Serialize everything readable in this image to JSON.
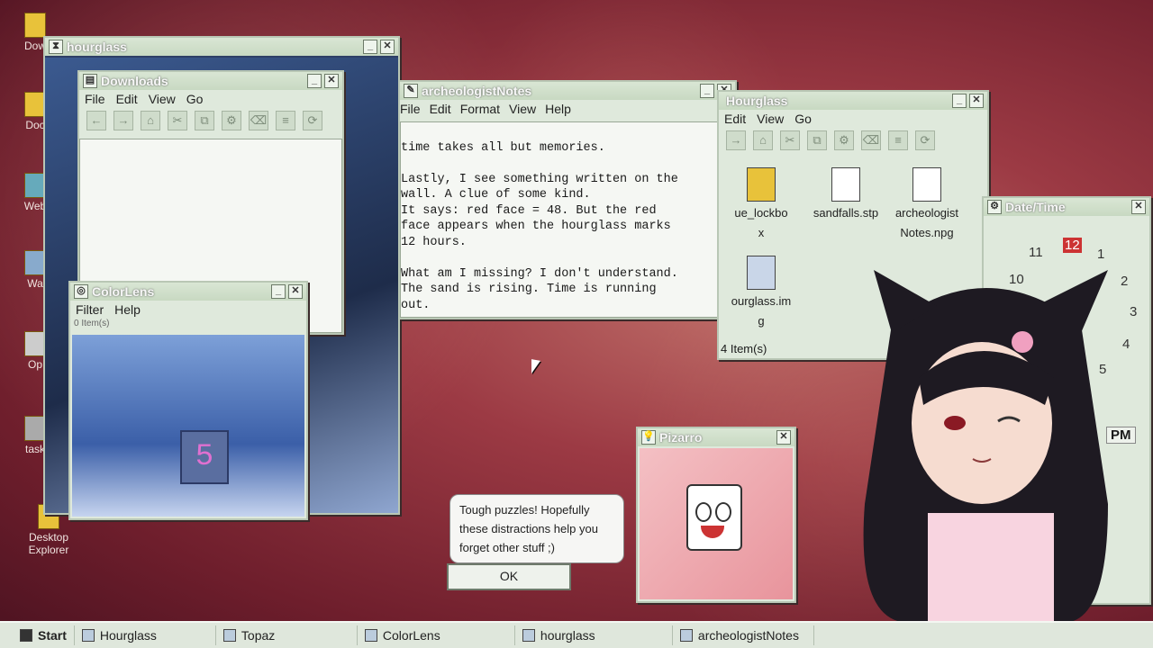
{
  "desktop": {
    "icons": [
      {
        "label": "Dow"
      },
      {
        "label": "Doc"
      },
      {
        "label": "Web"
      },
      {
        "label": "Wa"
      },
      {
        "label": "Op"
      },
      {
        "label": "task"
      },
      {
        "label": "Desktop Explorer"
      }
    ]
  },
  "hourglass_win": {
    "title": "hourglass"
  },
  "downloads": {
    "title": "Downloads",
    "menu": [
      "File",
      "Edit",
      "View",
      "Go"
    ]
  },
  "colorlens": {
    "title": "ColorLens",
    "menu": [
      "Filter",
      "Help"
    ],
    "status": "0 Item(s)",
    "digit": "5"
  },
  "notes": {
    "title": "archeologistNotes",
    "menu": [
      "File",
      "Edit",
      "Format",
      "View",
      "Help"
    ],
    "lines": [
      "time takes all but memories.",
      "",
      "Lastly, I see something written on the",
      "wall. A clue of some kind.",
      "It says: red face = 48. But the red",
      "face appears when the hourglass marks",
      "12 hours.",
      "",
      "What am I missing? I don't understand.",
      "The sand is rising. Time is running",
      "out."
    ]
  },
  "explorer": {
    "title": "Hourglass",
    "menu": [
      "Edit",
      "View",
      "Go"
    ],
    "status": "4 Item(s)",
    "files": [
      {
        "name": "ue_lockbo\nx"
      },
      {
        "name": "sandfalls.stp"
      },
      {
        "name": "archeologist\nNotes.npg"
      },
      {
        "name": "ourglass.im\ng"
      }
    ]
  },
  "datetime": {
    "title": "Date/Time",
    "numbers": [
      "11",
      "12",
      "1",
      "10",
      "2",
      "3",
      "4",
      "5"
    ],
    "ampm": "PM"
  },
  "pizarro": {
    "title": "Pizarro",
    "message": "Tough puzzles! Hopefully these distractions help you forget other stuff ;)",
    "ok": "OK"
  },
  "taskbar": {
    "start": "Start",
    "items": [
      "Hourglass",
      "Topaz",
      "ColorLens",
      "hourglass",
      "archeologistNotes"
    ]
  },
  "colors": {
    "titlebar": "#c8d9c2",
    "window": "#dfe9dc",
    "desktop": "#9c3a44"
  }
}
